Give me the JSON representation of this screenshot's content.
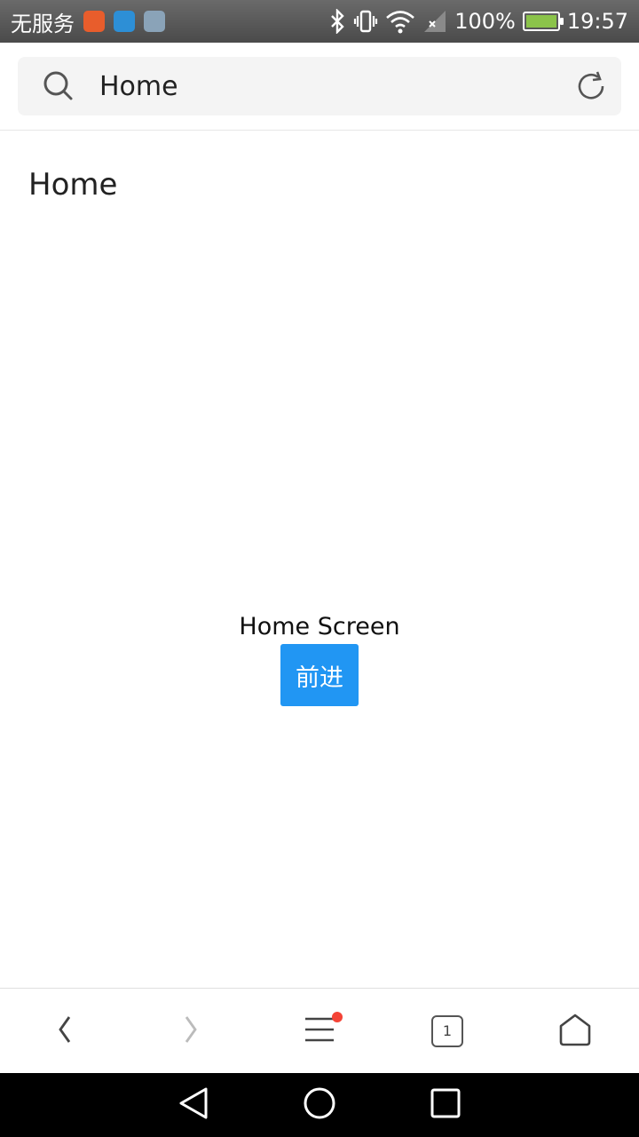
{
  "status_bar": {
    "carrier": "无服务",
    "battery_percent": "100%",
    "time": "19:57",
    "icons": [
      "bluetooth-icon",
      "vibrate-icon",
      "wifi-icon",
      "signal-icon",
      "battery-icon"
    ],
    "app_icons": [
      "uc-browser-app-icon",
      "usb-icon",
      "gallery-icon"
    ]
  },
  "address_bar": {
    "url_text": "Home"
  },
  "page": {
    "heading": "Home",
    "screen_label": "Home Screen",
    "forward_button_label": "前进"
  },
  "toolbar": {
    "tab_count": "1",
    "items": [
      "back",
      "forward",
      "menu",
      "tabs",
      "home"
    ]
  },
  "colors": {
    "accent": "#2196f3",
    "badge": "#f44336",
    "battery": "#8bc34a"
  }
}
